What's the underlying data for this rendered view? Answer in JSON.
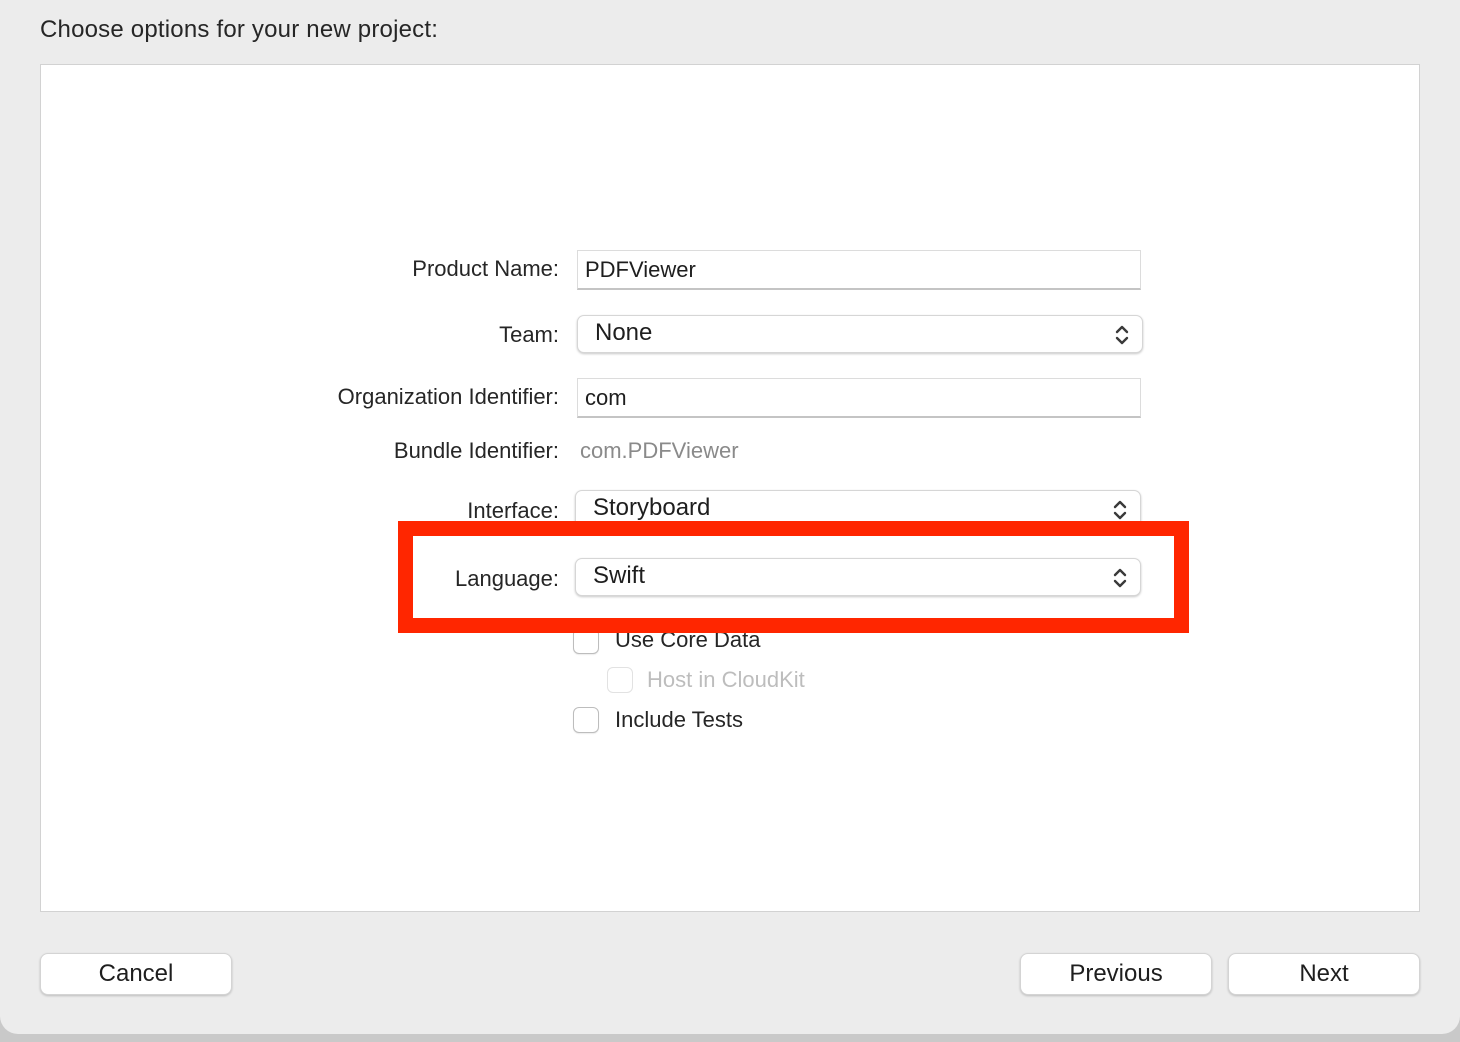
{
  "dialog": {
    "title": "Choose options for your new project:"
  },
  "form": {
    "product_name": {
      "label": "Product Name:",
      "value": "PDFViewer"
    },
    "team": {
      "label": "Team:",
      "value": "None"
    },
    "organization_identifier": {
      "label": "Organization Identifier:",
      "value": "com"
    },
    "bundle_identifier": {
      "label": "Bundle Identifier:",
      "value": "com.PDFViewer"
    },
    "interface": {
      "label": "Interface:",
      "value": "Storyboard"
    },
    "language": {
      "label": "Language:",
      "value": "Swift"
    },
    "use_core_data": {
      "label": "Use Core Data",
      "checked": false
    },
    "host_in_cloudkit": {
      "label": "Host in CloudKit",
      "checked": false,
      "disabled": true
    },
    "include_tests": {
      "label": "Include Tests",
      "checked": false
    }
  },
  "buttons": {
    "cancel": "Cancel",
    "previous": "Previous",
    "next": "Next"
  },
  "colors": {
    "highlight": "#ff2600",
    "sheet_background": "#ececec",
    "panel_background": "#ffffff"
  },
  "icons": {
    "popup_indicator": "chevron-up-down-icon"
  }
}
